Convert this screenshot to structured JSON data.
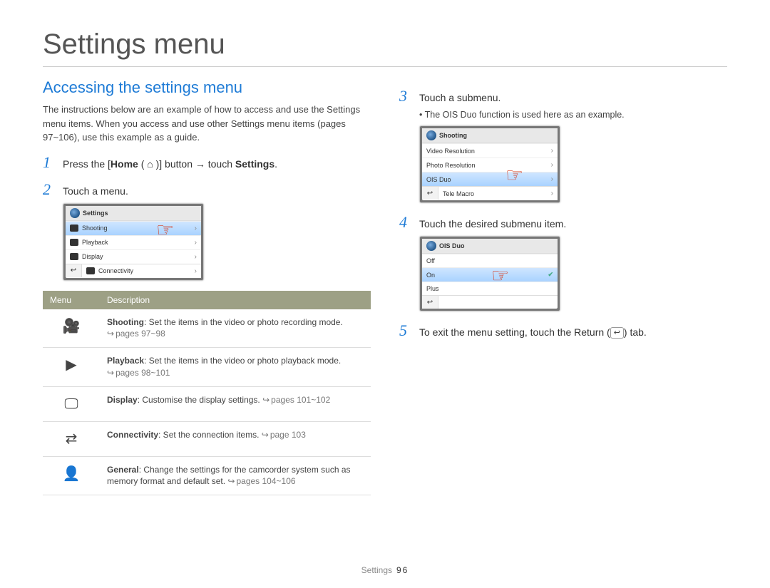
{
  "title": "Settings menu",
  "section": "Accessing the settings menu",
  "intro": "The instructions below are an example of how to access and use the Settings menu items. When you access and use other Settings menu items (pages 97~106), use this example as a guide.",
  "steps": {
    "s1_prefix": "Press the [",
    "s1_home": "Home",
    "s1_mid": " ( ⌂ )] button → touch ",
    "s1_settings": "Settings",
    "s1_suffix": ".",
    "s2": "Touch a menu.",
    "s3": "Touch a submenu.",
    "s3_note": "The OIS Duo function is used here as an example.",
    "s4": "Touch the desired submenu item.",
    "s5_prefix": "To exit the menu setting, touch the Return (",
    "s5_suffix": ") tab."
  },
  "screen1": {
    "title": "Settings",
    "rows": [
      "Shooting",
      "Playback",
      "Display",
      "Connectivity"
    ]
  },
  "screen2": {
    "title": "Shooting",
    "rows": [
      "Video Resolution",
      "Photo Resolution",
      "OIS Duo",
      "Tele Macro"
    ]
  },
  "screen3": {
    "title": "OIS Duo",
    "rows": [
      "Off",
      "On",
      "Plus"
    ]
  },
  "table": {
    "h1": "Menu",
    "h2": "Description",
    "rows": [
      {
        "name": "Shooting",
        "desc": ": Set the items in the video or photo recording mode.",
        "pref": "pages 97~98"
      },
      {
        "name": "Playback",
        "desc": ": Set the items in the video or photo playback mode.",
        "pref": "pages 98~101"
      },
      {
        "name": "Display",
        "desc": ": Customise the display settings. ",
        "pref": "pages 101~102"
      },
      {
        "name": "Connectivity",
        "desc": ": Set the connection items. ",
        "pref": "page 103"
      },
      {
        "name": "General",
        "desc": ": Change the settings for the camcorder system such as memory format and default set. ",
        "pref": "pages 104~106"
      }
    ]
  },
  "footer": {
    "label": "Settings",
    "page": "96"
  }
}
